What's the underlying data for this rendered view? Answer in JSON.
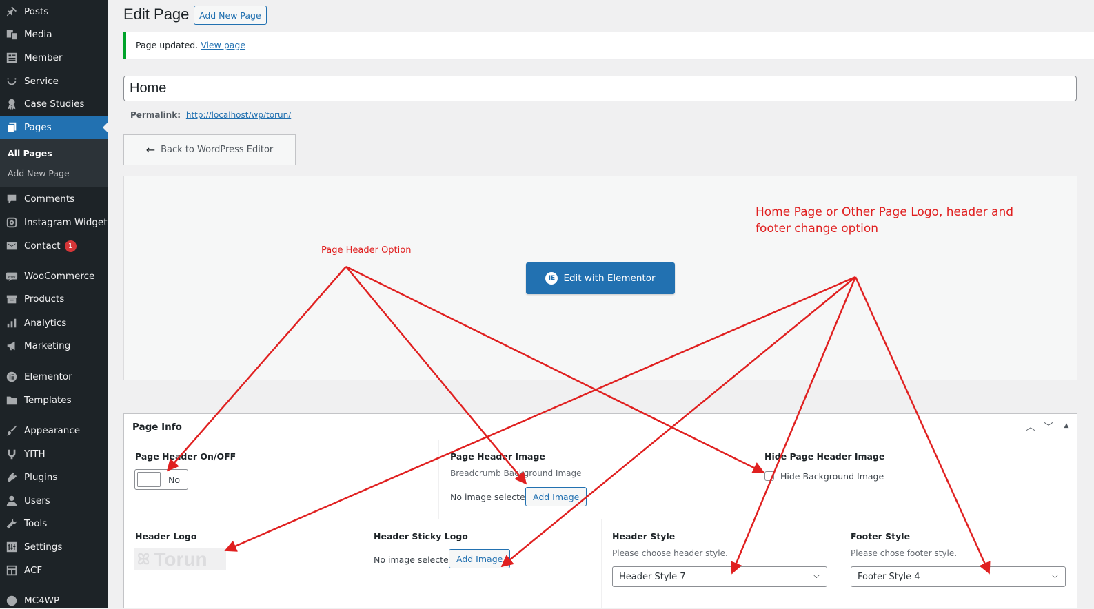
{
  "sidebar": {
    "items": [
      {
        "label": "Posts",
        "icon": "pin-icon"
      },
      {
        "label": "Media",
        "icon": "media-icon"
      },
      {
        "label": "Member",
        "icon": "member-icon"
      },
      {
        "label": "Service",
        "icon": "service-icon"
      },
      {
        "label": "Case Studies",
        "icon": "award-icon"
      },
      {
        "label": "Pages",
        "icon": "pages-icon",
        "active": true
      },
      {
        "label": "Comments",
        "icon": "comment-icon"
      },
      {
        "label": "Instagram Widget",
        "icon": "instagram-icon"
      },
      {
        "label": "Contact",
        "icon": "mail-icon",
        "badge": "1"
      },
      {
        "label": "WooCommerce",
        "icon": "woocommerce-icon"
      },
      {
        "label": "Products",
        "icon": "products-icon"
      },
      {
        "label": "Analytics",
        "icon": "analytics-icon"
      },
      {
        "label": "Marketing",
        "icon": "megaphone-icon"
      },
      {
        "label": "Elementor",
        "icon": "elementor-icon"
      },
      {
        "label": "Templates",
        "icon": "folder-icon"
      },
      {
        "label": "Appearance",
        "icon": "brush-icon"
      },
      {
        "label": "YITH",
        "icon": "yith-icon"
      },
      {
        "label": "Plugins",
        "icon": "plugin-icon"
      },
      {
        "label": "Users",
        "icon": "users-icon"
      },
      {
        "label": "Tools",
        "icon": "wrench-icon"
      },
      {
        "label": "Settings",
        "icon": "settings-icon"
      },
      {
        "label": "ACF",
        "icon": "acf-icon"
      },
      {
        "label": "MC4WP",
        "icon": "mc4wp-icon"
      }
    ],
    "submenu": [
      {
        "label": "All Pages",
        "current": true
      },
      {
        "label": "Add New Page"
      }
    ]
  },
  "header": {
    "title": "Edit Page",
    "add_new_label": "Add New Page"
  },
  "notice": {
    "text": "Page updated.",
    "link_text": "View page"
  },
  "editor": {
    "page_title": "Home",
    "permalink_label": "Permalink:",
    "permalink_url": "http://localhost/wp/torun/",
    "back_button_label": "Back to WordPress Editor",
    "elementor_button_label": "Edit with Elementor"
  },
  "page_info": {
    "title": "Page Info",
    "controls": [
      "^",
      "v",
      "▲"
    ],
    "page_header_toggle": {
      "label": "Page Header On/OFF",
      "state": "No"
    },
    "page_header_image": {
      "label": "Page Header Image",
      "desc": "Breadcrumb Background Image",
      "no_image": "No image selected",
      "button": "Add Image"
    },
    "hide_page_header_image": {
      "label": "Hide Page Header Image",
      "checkbox_label": "Hide Background Image",
      "checked": false
    },
    "header_logo": {
      "label": "Header Logo",
      "logo_text": "Torun"
    },
    "header_sticky_logo": {
      "label": "Header Sticky Logo",
      "no_image": "No image selected",
      "button": "Add Image"
    },
    "header_style": {
      "label": "Header Style",
      "desc": "Please choose header style.",
      "value": "Header Style 7"
    },
    "footer_style": {
      "label": "Footer Style",
      "desc": "Please chose footer style.",
      "value": "Footer Style 4"
    }
  },
  "annotations": {
    "page_header_option": "Page Header Option",
    "logo_option_line1": "Home Page or Other Page Logo, header and",
    "logo_option_line2": "footer change option",
    "color": "#e02020"
  },
  "colors": {
    "sidebar_bg": "#1d2327",
    "accent": "#2271b1",
    "notice_success": "#00a32a",
    "badge": "#d63638"
  }
}
